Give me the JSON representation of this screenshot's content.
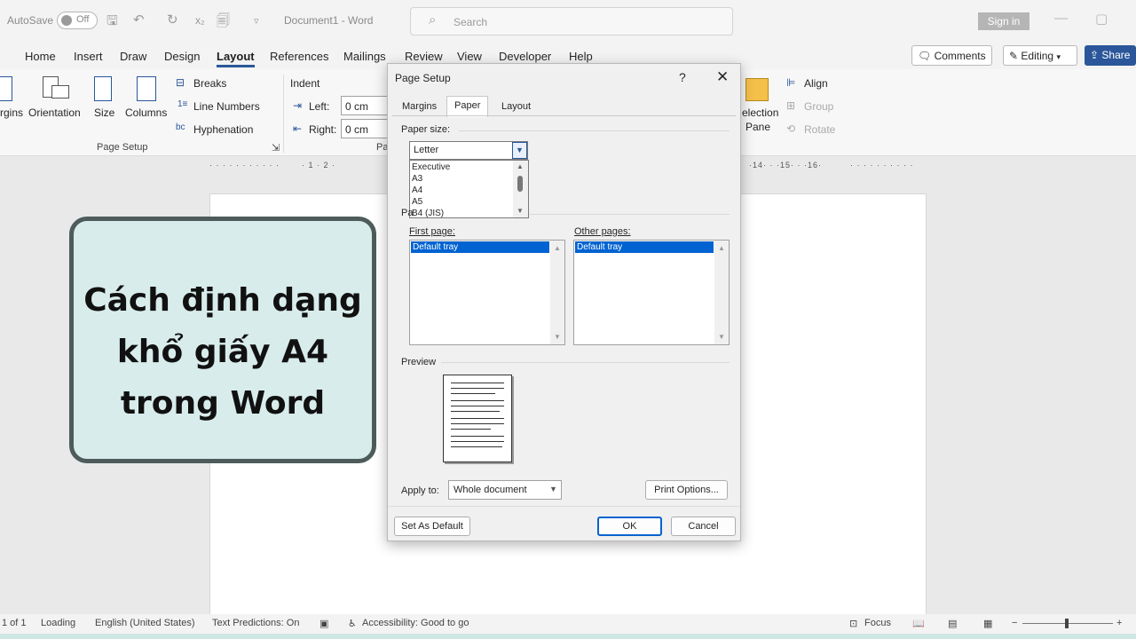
{
  "titlebar": {
    "autosave_label": "AutoSave",
    "autosave_state": "Off",
    "doc_title": "Document1  -  Word",
    "search_placeholder": "Search",
    "signin": "Sign in"
  },
  "menu": {
    "tabs": [
      "Home",
      "Insert",
      "Draw",
      "Design",
      "Layout",
      "References",
      "Mailings",
      "Review",
      "View",
      "Developer",
      "Help"
    ],
    "comments": "Comments",
    "editing": "Editing",
    "share": "Share"
  },
  "ribbon": {
    "margins": "rgins",
    "orientation": "Orientation",
    "size": "Size",
    "columns": "Columns",
    "breaks": "Breaks",
    "line_numbers": "Line Numbers",
    "hyphenation": "Hyphenation",
    "page_setup_group": "Page Setup",
    "indent": "Indent",
    "left_label": "Left:",
    "left_value": "0 cm",
    "right_label": "Right:",
    "right_value": "0 cm",
    "pa": "Pa",
    "selection": "election",
    "pane": "Pane",
    "align": "Align",
    "group": "Group",
    "rotate": "Rotate"
  },
  "ruler": {
    "left_marks": "· 1 · 2 ·",
    "right_marks": "·14· · ·15· · ·16·"
  },
  "card": {
    "lines": [
      "Cách định dạng",
      "khổ giấy A4",
      "trong Word"
    ]
  },
  "dialog": {
    "title": "Page Setup",
    "help": "?",
    "close": "✕",
    "tabs": [
      "Margins",
      "Paper",
      "Layout"
    ],
    "paper_size_label": "Paper size:",
    "paper_size_value": "Letter",
    "paper_options": [
      "Executive",
      "A3",
      "A4",
      "A5",
      "B4 (JIS)"
    ],
    "paper_source_label": "Pa",
    "first_page_label": "First page:",
    "other_pages_label": "Other pages:",
    "first_tray": "Default tray",
    "other_tray": "Default tray",
    "preview_label": "Preview",
    "apply_label": "Apply to:",
    "apply_value": "Whole document",
    "print_options": "Print Options...",
    "set_default": "Set As Default",
    "ok": "OK",
    "cancel": "Cancel"
  },
  "status": {
    "page": "1 of 1",
    "loading": "Loading",
    "language": "English (United States)",
    "predictions": "Text Predictions: On",
    "accessibility": "Accessibility: Good to go",
    "focus": "Focus"
  },
  "colors": {
    "accent": "#2b579a",
    "selection": "#0063d1",
    "card_bg": "#d9ecec",
    "card_border": "#4d5b5b"
  }
}
